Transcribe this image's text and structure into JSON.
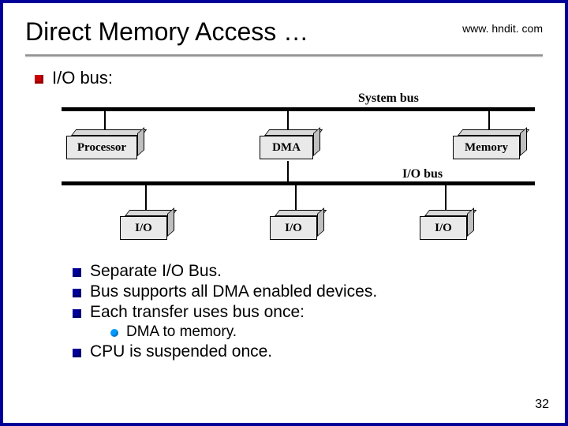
{
  "header": {
    "title": "Direct Memory Access …",
    "url": "www. hndit. com"
  },
  "bullets": {
    "b1": "I/O bus:",
    "sub": {
      "s1": "Separate I/O Bus.",
      "s2": "Bus supports all DMA enabled devices.",
      "s3": "Each transfer uses bus once:",
      "s3a": "DMA to memory.",
      "s4": "CPU is suspended once."
    }
  },
  "diagram": {
    "system_bus_label": "System bus",
    "io_bus_label": "I/O bus",
    "boxes": {
      "processor": "Processor",
      "dma": "DMA",
      "memory": "Memory",
      "io1": "I/O",
      "io2": "I/O",
      "io3": "I/O"
    }
  },
  "slide_number": "32"
}
